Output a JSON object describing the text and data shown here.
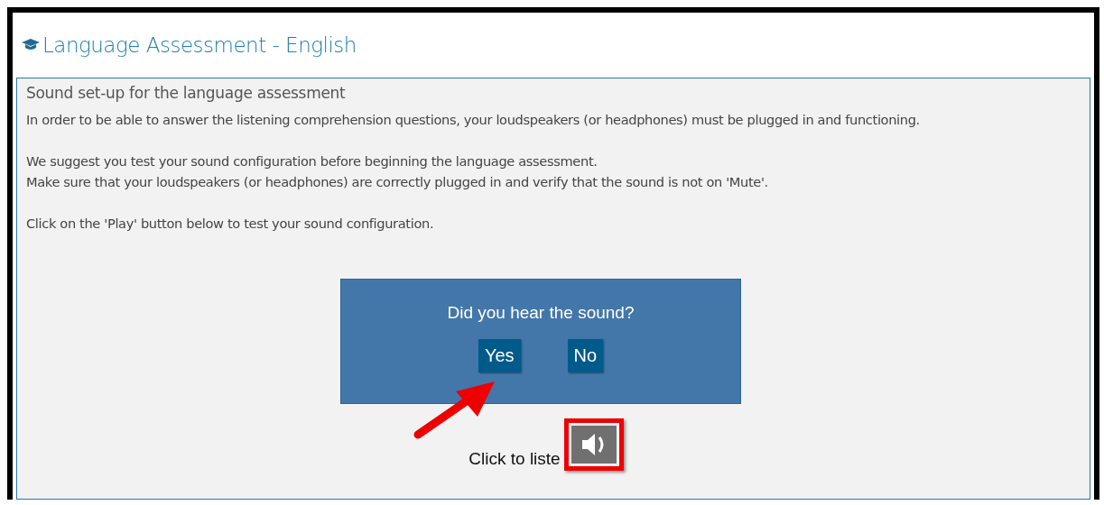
{
  "header": {
    "title": "Language Assessment - English"
  },
  "panel": {
    "heading": "Sound set-up for the language assessment",
    "paragraphs": [
      [
        "In order to be able to answer the listening comprehension questions, your loudspeakers (or headphones) must be plugged in and functioning."
      ],
      [
        "We suggest you test your sound configuration before beginning the language assessment.",
        "Make sure that your loudspeakers (or headphones) are correctly plugged in and verify that the sound is not on 'Mute'."
      ],
      [
        "Click on the 'Play' button below to test your sound configuration."
      ]
    ]
  },
  "dialog": {
    "question": "Did you hear the sound?",
    "buttons": [
      "Yes",
      "No"
    ]
  },
  "player": {
    "label": "Click to liste"
  }
}
